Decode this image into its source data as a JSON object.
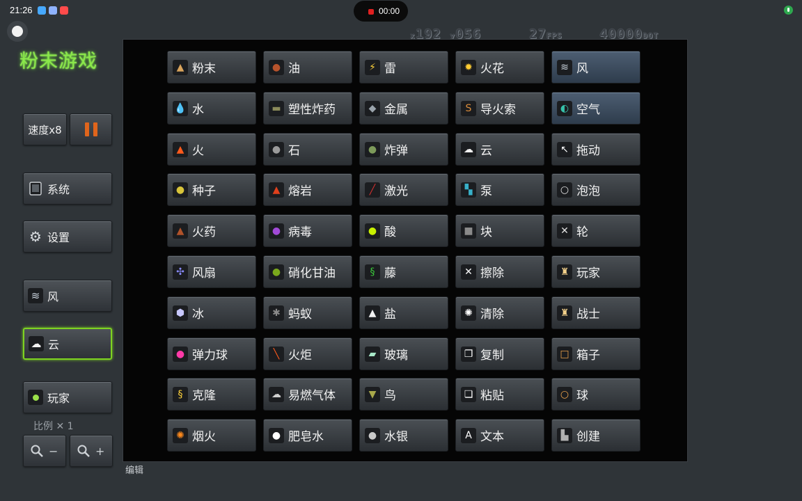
{
  "status_bar": {
    "time": "21:26",
    "recording_time": "00:00",
    "indicator_colors": [
      "#47a9ff",
      "#8fb3ff",
      "#ff4b4b"
    ]
  },
  "hud": {
    "x_label": "x",
    "x_value": "192",
    "y_label": "y",
    "y_value": "056",
    "fps_value": "27",
    "fps_label": "FPS",
    "dot_value": "40000",
    "dot_label": "DOT"
  },
  "title": "粉末游戏",
  "sidebar": {
    "speed_label": "速度x8",
    "system_label": "系统",
    "settings_label": "设置",
    "wind_label": "风",
    "cloud_label": "云",
    "player_label": "玩家",
    "scale_label": "比例 ✕ 1",
    "zoom_out_sign": "−",
    "zoom_in_sign": "+"
  },
  "edit_label": "编辑",
  "elements": [
    [
      {
        "label": "粉末",
        "icon": "sand-pile-icon",
        "glyph": "▲",
        "color": "#d9a45c"
      },
      {
        "label": "油",
        "icon": "oil-drop-icon",
        "glyph": "●",
        "color": "#b7532c"
      },
      {
        "label": "雷",
        "icon": "lightning-icon",
        "glyph": "⚡",
        "color": "#ffd23a"
      },
      {
        "label": "火花",
        "icon": "spark-icon",
        "glyph": "✹",
        "color": "#ffcc33"
      },
      {
        "label": "风",
        "icon": "wind-swirl-icon",
        "glyph": "≋",
        "color": "#c8d2dc",
        "selected": true
      }
    ],
    [
      {
        "label": "水",
        "icon": "water-drop-icon",
        "glyph": "💧",
        "color": "#3a8cff"
      },
      {
        "label": "塑性炸药",
        "icon": "plastic-explosive-icon",
        "glyph": "▬",
        "color": "#8a8a5a"
      },
      {
        "label": "金属",
        "icon": "metal-bar-icon",
        "glyph": "◆",
        "color": "#9aa3ab"
      },
      {
        "label": "导火索",
        "icon": "fuse-icon",
        "glyph": "S",
        "color": "#d98b3a"
      },
      {
        "label": "空气",
        "icon": "air-globe-icon",
        "glyph": "◐",
        "color": "#36c0a8",
        "selected": true
      }
    ],
    [
      {
        "label": "火",
        "icon": "fire-icon",
        "glyph": "▲",
        "color": "#ff5a1c"
      },
      {
        "label": "石",
        "icon": "stone-icon",
        "glyph": "●",
        "color": "#9a9a9a"
      },
      {
        "label": "炸弹",
        "icon": "bomb-icon",
        "glyph": "●",
        "color": "#7d9a5a"
      },
      {
        "label": "云",
        "icon": "cloud-icon",
        "glyph": "☁",
        "color": "#f2f2f2"
      },
      {
        "label": "拖动",
        "icon": "drag-cursor-icon",
        "glyph": "↖",
        "color": "#ffffff"
      }
    ],
    [
      {
        "label": "种子",
        "icon": "seed-icon",
        "glyph": "●",
        "color": "#d8c43a"
      },
      {
        "label": "熔岩",
        "icon": "lava-icon",
        "glyph": "▲",
        "color": "#e0401c"
      },
      {
        "label": "激光",
        "icon": "laser-icon",
        "glyph": "╱",
        "color": "#d03030"
      },
      {
        "label": "泵",
        "icon": "pump-icon",
        "glyph": "▚",
        "color": "#38b0c8"
      },
      {
        "label": "泡泡",
        "icon": "bubble-icon",
        "glyph": "○",
        "color": "#e0e0e0"
      }
    ],
    [
      {
        "label": "火药",
        "icon": "gunpowder-icon",
        "glyph": "▲",
        "color": "#b0522a"
      },
      {
        "label": "病毒",
        "icon": "virus-icon",
        "glyph": "●",
        "color": "#a24ad8"
      },
      {
        "label": "酸",
        "icon": "acid-drop-icon",
        "glyph": "●",
        "color": "#c8f000"
      },
      {
        "label": "块",
        "icon": "block-icon",
        "glyph": "■",
        "color": "#8a8a8a"
      },
      {
        "label": "轮",
        "icon": "wheel-icon",
        "glyph": "✕",
        "color": "#e0e0e0"
      }
    ],
    [
      {
        "label": "风扇",
        "icon": "fan-icon",
        "glyph": "✣",
        "color": "#8a8cff"
      },
      {
        "label": "硝化甘油",
        "icon": "nitro-drop-icon",
        "glyph": "●",
        "color": "#7aa81c"
      },
      {
        "label": "藤",
        "icon": "vine-icon",
        "glyph": "§",
        "color": "#3ac83a"
      },
      {
        "label": "擦除",
        "icon": "erase-x-icon",
        "glyph": "✕",
        "color": "#ffffff"
      },
      {
        "label": "玩家",
        "icon": "player-figure-icon",
        "glyph": "♜",
        "color": "#f2d08a"
      }
    ],
    [
      {
        "label": "冰",
        "icon": "ice-cube-icon",
        "glyph": "⬢",
        "color": "#c8c8ff"
      },
      {
        "label": "蚂蚁",
        "icon": "ant-icon",
        "glyph": "✱",
        "color": "#8a8a8a"
      },
      {
        "label": "盐",
        "icon": "salt-pile-icon",
        "glyph": "▲",
        "color": "#f0f0f0"
      },
      {
        "label": "清除",
        "icon": "clear-dots-icon",
        "glyph": "✺",
        "color": "#ffffff"
      },
      {
        "label": "战士",
        "icon": "fighter-figure-icon",
        "glyph": "♜",
        "color": "#f2d08a"
      }
    ],
    [
      {
        "label": "弹力球",
        "icon": "bouncy-ball-icon",
        "glyph": "●",
        "color": "#ff3aa8"
      },
      {
        "label": "火炬",
        "icon": "torch-icon",
        "glyph": "╲",
        "color": "#ff5a1c"
      },
      {
        "label": "玻璃",
        "icon": "glass-icon",
        "glyph": "▰",
        "color": "#a8e8c8"
      },
      {
        "label": "复制",
        "icon": "copy-icon",
        "glyph": "❐",
        "color": "#ffffff"
      },
      {
        "label": "箱子",
        "icon": "box-icon",
        "glyph": "□",
        "color": "#e8a04a"
      }
    ],
    [
      {
        "label": "克隆",
        "icon": "clone-icon",
        "glyph": "§",
        "color": "#ffd23a"
      },
      {
        "label": "易燃气体",
        "icon": "flammable-gas-icon",
        "glyph": "☁",
        "color": "#d0d0d0"
      },
      {
        "label": "鸟",
        "icon": "bird-icon",
        "glyph": "▼",
        "color": "#a8a84a"
      },
      {
        "label": "粘贴",
        "icon": "paste-icon",
        "glyph": "❏",
        "color": "#ffffff"
      },
      {
        "label": "球",
        "icon": "ball-ring-icon",
        "glyph": "○",
        "color": "#e8a04a"
      }
    ],
    [
      {
        "label": "烟火",
        "icon": "firework-icon",
        "glyph": "✺",
        "color": "#ff8a1c"
      },
      {
        "label": "肥皂水",
        "icon": "soap-drop-icon",
        "glyph": "●",
        "color": "#ffffff"
      },
      {
        "label": "水银",
        "icon": "mercury-drop-icon",
        "glyph": "●",
        "color": "#c8c8c8"
      },
      {
        "label": "文本",
        "icon": "text-a-icon",
        "glyph": "A",
        "color": "#ffffff"
      },
      {
        "label": "创建",
        "icon": "factory-icon",
        "glyph": "▙",
        "color": "#b0b0b0"
      }
    ]
  ]
}
